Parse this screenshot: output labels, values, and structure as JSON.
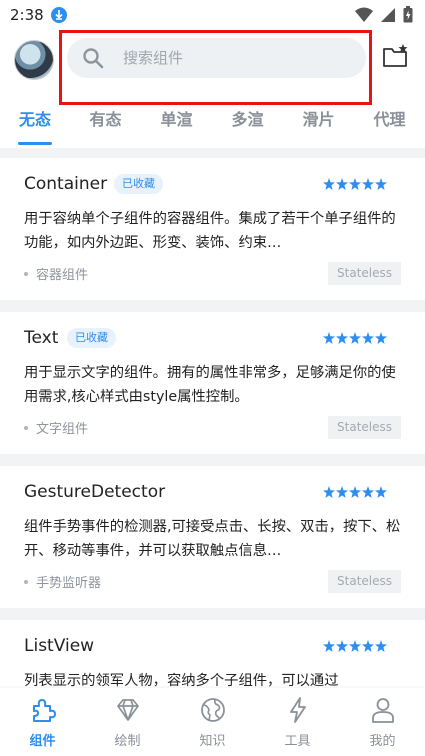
{
  "status_bar": {
    "time": "2:38"
  },
  "header": {
    "search_placeholder": "搜索组件"
  },
  "tabs": [
    {
      "label": "无态",
      "active": true
    },
    {
      "label": "有态",
      "active": false
    },
    {
      "label": "单渲",
      "active": false
    },
    {
      "label": "多渲",
      "active": false
    },
    {
      "label": "滑片",
      "active": false
    },
    {
      "label": "代理",
      "active": false
    }
  ],
  "cards": [
    {
      "title": "Container",
      "badge": "已收藏",
      "stars": 5,
      "description": "用于容纳单个子组件的容器组件。集成了若干个单子组件的功能，如内外边距、形变、装饰、约束…",
      "category": "容器组件",
      "type": "Stateless"
    },
    {
      "title": "Text",
      "badge": "已收藏",
      "stars": 5,
      "description": "用于显示文字的组件。拥有的属性非常多，足够满足你的使用需求,核心样式由style属性控制。",
      "category": "文字组件",
      "type": "Stateless"
    },
    {
      "title": "GestureDetector",
      "badge": "",
      "stars": 5,
      "description": "组件手势事件的检测器,可接受点击、长按、双击，按下、松开、移动等事件，并可以获取触点信息…",
      "category": "手势监听器",
      "type": "Stateless"
    },
    {
      "title": "ListView",
      "badge": "",
      "stars": 5,
      "description": "列表显示的领军人物，容纳多个子组件，可以通过",
      "category": "",
      "type": ""
    }
  ],
  "bottom_nav": [
    {
      "label": "组件",
      "icon": "puzzle-icon",
      "active": true
    },
    {
      "label": "绘制",
      "icon": "diamond-icon",
      "active": false
    },
    {
      "label": "知识",
      "icon": "globe-icon",
      "active": false
    },
    {
      "label": "工具",
      "icon": "lightning-icon",
      "active": false
    },
    {
      "label": "我的",
      "icon": "person-icon",
      "active": false
    }
  ],
  "colors": {
    "accent": "#2d8ef0",
    "highlight": "#ee1111"
  }
}
